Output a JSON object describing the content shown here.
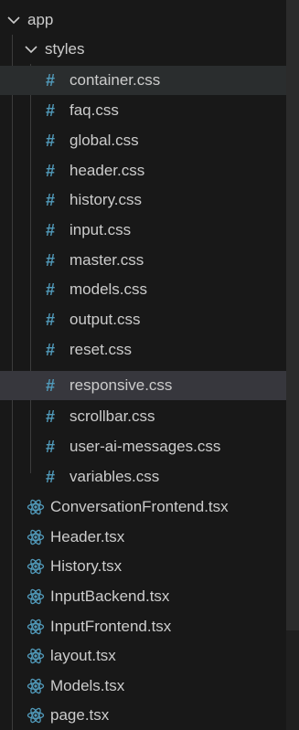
{
  "tree": {
    "root_folder": "app",
    "sub_folder": "styles",
    "css_files": [
      "container.css",
      "faq.css",
      "global.css",
      "header.css",
      "history.css",
      "input.css",
      "master.css",
      "models.css",
      "output.css",
      "reset.css",
      "responsive.css",
      "scrollbar.css",
      "user-ai-messages.css",
      "variables.css"
    ],
    "tsx_files": [
      "ConversationFrontend.tsx",
      "Header.tsx",
      "History.tsx",
      "InputBackend.tsx",
      "InputFrontend.tsx",
      "layout.tsx",
      "Models.tsx",
      "page.tsx"
    ]
  },
  "icons": {
    "folder_chevron": "chevron-down-icon",
    "css_file": "hash-icon",
    "tsx_file": "react-icon"
  },
  "colors": {
    "background": "#181818",
    "css_icon": "#519aba",
    "react_icon": "#519aba",
    "hover_row": "#2a2d2e",
    "selected_row": "#37373d"
  }
}
